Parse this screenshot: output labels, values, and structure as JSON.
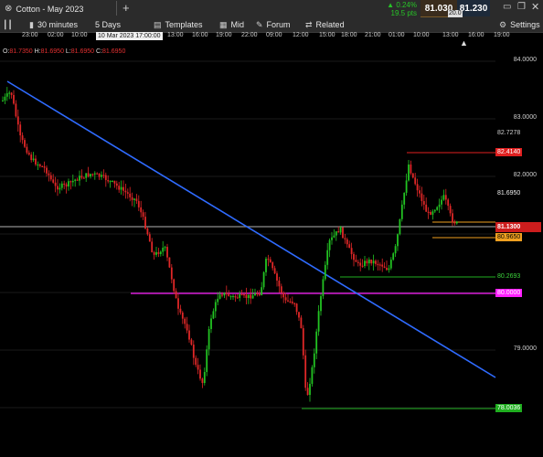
{
  "header": {
    "instrument_tab": "Cotton - May 2023",
    "close_glyph": "⊗",
    "add_tab_glyph": "+",
    "change_pct": "0.24%",
    "change_pts": "19.5 pts",
    "sell_price": "81.030",
    "buy_price": "81.230",
    "spread": "20.0"
  },
  "toolbar": {
    "interval": "30 minutes",
    "range": "5 Days",
    "templates": "Templates",
    "mid": "Mid",
    "forum": "Forum",
    "related": "Related",
    "settings": "Settings"
  },
  "time_axis": [
    "23:00",
    "02:00",
    "10:00",
    "13:00",
    "16:00",
    "19:00",
    "22:00",
    "09:00",
    "12:00",
    "15:00",
    "18:00",
    "21:00",
    "01:00",
    "10:00",
    "13:00",
    "16:00",
    "19:00",
    "22:00",
    "01:00"
  ],
  "hover_timestamp": "10 Mar 2023 17:00:00",
  "ohlc": {
    "o_label": "O:",
    "o": "81.7350",
    "h_label": "H:",
    "h": "81.6950",
    "l_label": "L:",
    "l": "81.6950",
    "c_label": "C:",
    "c": "81.6950"
  },
  "price_axis": [
    "84.0000",
    "83.0000",
    "82.0000",
    "79.0000"
  ],
  "price_labels": {
    "red_level": "82.4140",
    "top_ref": "82.7278",
    "current_white": "81.6950",
    "gray_line": "81.1300",
    "orange": "80.9650",
    "green_mid": "80.2693",
    "magenta": "80.0000",
    "green_low": "78.0036"
  },
  "colors": {
    "bull": "#22c322",
    "bear": "#e02727",
    "trend": "#2f6bff",
    "magenta": "#ff1fff",
    "red_line": "#e02020",
    "orange": "#f0a020",
    "green_line": "#1fae1f",
    "gray_line": "#9a9a9a",
    "bg": "#000000",
    "panel": "#2b2b2b"
  }
}
